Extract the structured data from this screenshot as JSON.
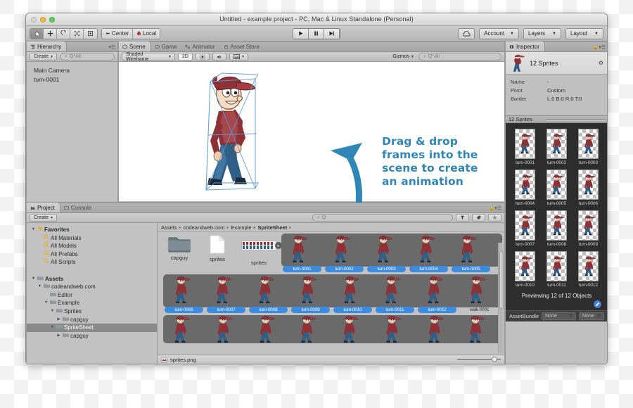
{
  "window": {
    "title": "Untitled - example project - PC, Mac & Linux Standalone (Personal)"
  },
  "toolbar": {
    "tools": [
      {
        "name": "hand-tool",
        "glyph": "✋"
      },
      {
        "name": "move-tool",
        "glyph": "✥"
      },
      {
        "name": "rotate-tool",
        "glyph": "↻"
      },
      {
        "name": "scale-tool",
        "glyph": "⤧"
      },
      {
        "name": "rect-tool",
        "glyph": "▣"
      }
    ],
    "pivot_mode": "Center",
    "pivot_rotation": "Local",
    "play": "▶",
    "pause": "❚❚",
    "step": "▶❘",
    "cloud": "cloud-icon",
    "account": "Account",
    "layers": "Layers",
    "layout": "Layout"
  },
  "hierarchy": {
    "tab": "Hierarchy",
    "create": "Create",
    "search_placeholder": "Q*All",
    "items": [
      "Main Camera",
      "turn-0001"
    ]
  },
  "scene": {
    "tabs": [
      {
        "label": "Scene",
        "active": true
      },
      {
        "label": "Game",
        "active": false
      },
      {
        "label": "Animator",
        "active": false
      },
      {
        "label": "Asset Store",
        "active": false
      }
    ],
    "draw_mode": "Shaded Wireframe",
    "mode_2d": "2D",
    "lighting": "☀",
    "audio": "🔊",
    "effects": "▭",
    "gizmos": "Gizmos",
    "search_placeholder": "Q*All",
    "callout": "Drag & drop frames into the scene to create an animation",
    "callout_lines": [
      "Drag & drop",
      "frames into the",
      "scene to create",
      "an animation"
    ]
  },
  "inspector": {
    "tab": "Inspector",
    "lock": "lock-icon",
    "object_title": "12 Sprites",
    "gear": "settings-icon",
    "properties": [
      {
        "key": "Name",
        "value": "-"
      },
      {
        "key": "Pivot",
        "value": "Custom"
      },
      {
        "key": "Border",
        "value": "L:0 B:0 R:0 T:0"
      }
    ],
    "sprites_header": "12 Sprites",
    "sprites": [
      "turn-0001",
      "turn-0002",
      "turn-0003",
      "turn-0004",
      "turn-0005",
      "turn-0006",
      "turn-0007",
      "turn-0008",
      "turn-0009",
      "turn-0010",
      "turn-0011",
      "turn-0012"
    ],
    "previewing": "Previewing 12 of 12 Objects",
    "assetbundle_label": "AssetBundle",
    "assetbundle_value": "None",
    "assetbundle_variant": "None"
  },
  "project": {
    "tabs": [
      {
        "label": "Project",
        "active": true
      },
      {
        "label": "Console",
        "active": false
      }
    ],
    "create": "Create",
    "search_placeholder": "Q",
    "breadcrumb": [
      "Assets",
      "codeandweb.com",
      "Example",
      "SpriteSheet"
    ],
    "tree": [
      {
        "label": "Favorites",
        "depth": 0,
        "twisty": "▼",
        "icon": "star-icon",
        "bold": true,
        "selected": false
      },
      {
        "label": "All Materials",
        "depth": 1,
        "twisty": "",
        "icon": "search-icon",
        "bold": false,
        "selected": false
      },
      {
        "label": "All Models",
        "depth": 1,
        "twisty": "",
        "icon": "search-icon",
        "bold": false,
        "selected": false
      },
      {
        "label": "All Prefabs",
        "depth": 1,
        "twisty": "",
        "icon": "search-icon",
        "bold": false,
        "selected": false
      },
      {
        "label": "All Scripts",
        "depth": 1,
        "twisty": "",
        "icon": "search-icon",
        "bold": false,
        "selected": false
      },
      {
        "label": "",
        "depth": 0,
        "twisty": "",
        "icon": "",
        "bold": false,
        "selected": false
      },
      {
        "label": "Assets",
        "depth": 0,
        "twisty": "▼",
        "icon": "folder-icon",
        "bold": true,
        "selected": false
      },
      {
        "label": "codeandweb.com",
        "depth": 1,
        "twisty": "▼",
        "icon": "folder-icon",
        "bold": false,
        "selected": false
      },
      {
        "label": "Editor",
        "depth": 2,
        "twisty": "",
        "icon": "folder-icon",
        "bold": false,
        "selected": false
      },
      {
        "label": "Example",
        "depth": 2,
        "twisty": "▼",
        "icon": "folder-icon",
        "bold": false,
        "selected": false
      },
      {
        "label": "Sprites",
        "depth": 3,
        "twisty": "▼",
        "icon": "folder-icon",
        "bold": false,
        "selected": false
      },
      {
        "label": "capguy",
        "depth": 4,
        "twisty": "▶",
        "icon": "folder-icon",
        "bold": false,
        "selected": false
      },
      {
        "label": "SpriteSheet",
        "depth": 3,
        "twisty": "▼",
        "icon": "folder-icon",
        "bold": false,
        "selected": true
      },
      {
        "label": "capguy",
        "depth": 4,
        "twisty": "▶",
        "icon": "folder-icon",
        "bold": false,
        "selected": false
      }
    ],
    "assets": [
      {
        "name": "capguy",
        "type": "folder"
      },
      {
        "name": "sprites",
        "type": "file"
      },
      {
        "name": "sprites",
        "type": "spritesheet"
      }
    ],
    "strip_rows": [
      [
        "turn-0001",
        "turn-0002",
        "turn-0003",
        "turn-0004",
        "turn-0005"
      ],
      [
        "turn-0006",
        "turn-0007",
        "turn-0008",
        "turn-0009",
        "turn-0010",
        "turn-0011",
        "turn-0012",
        "walk-0001"
      ]
    ],
    "statusbar_file": "sprites.png"
  },
  "colors": {
    "accent_blue": "#3b8ce0",
    "callout_blue": "#2f87b7",
    "panel_gray": "#c2c2c2",
    "dark_preview": "#2d2d2d",
    "selection_gray": "#8a8a8a"
  }
}
